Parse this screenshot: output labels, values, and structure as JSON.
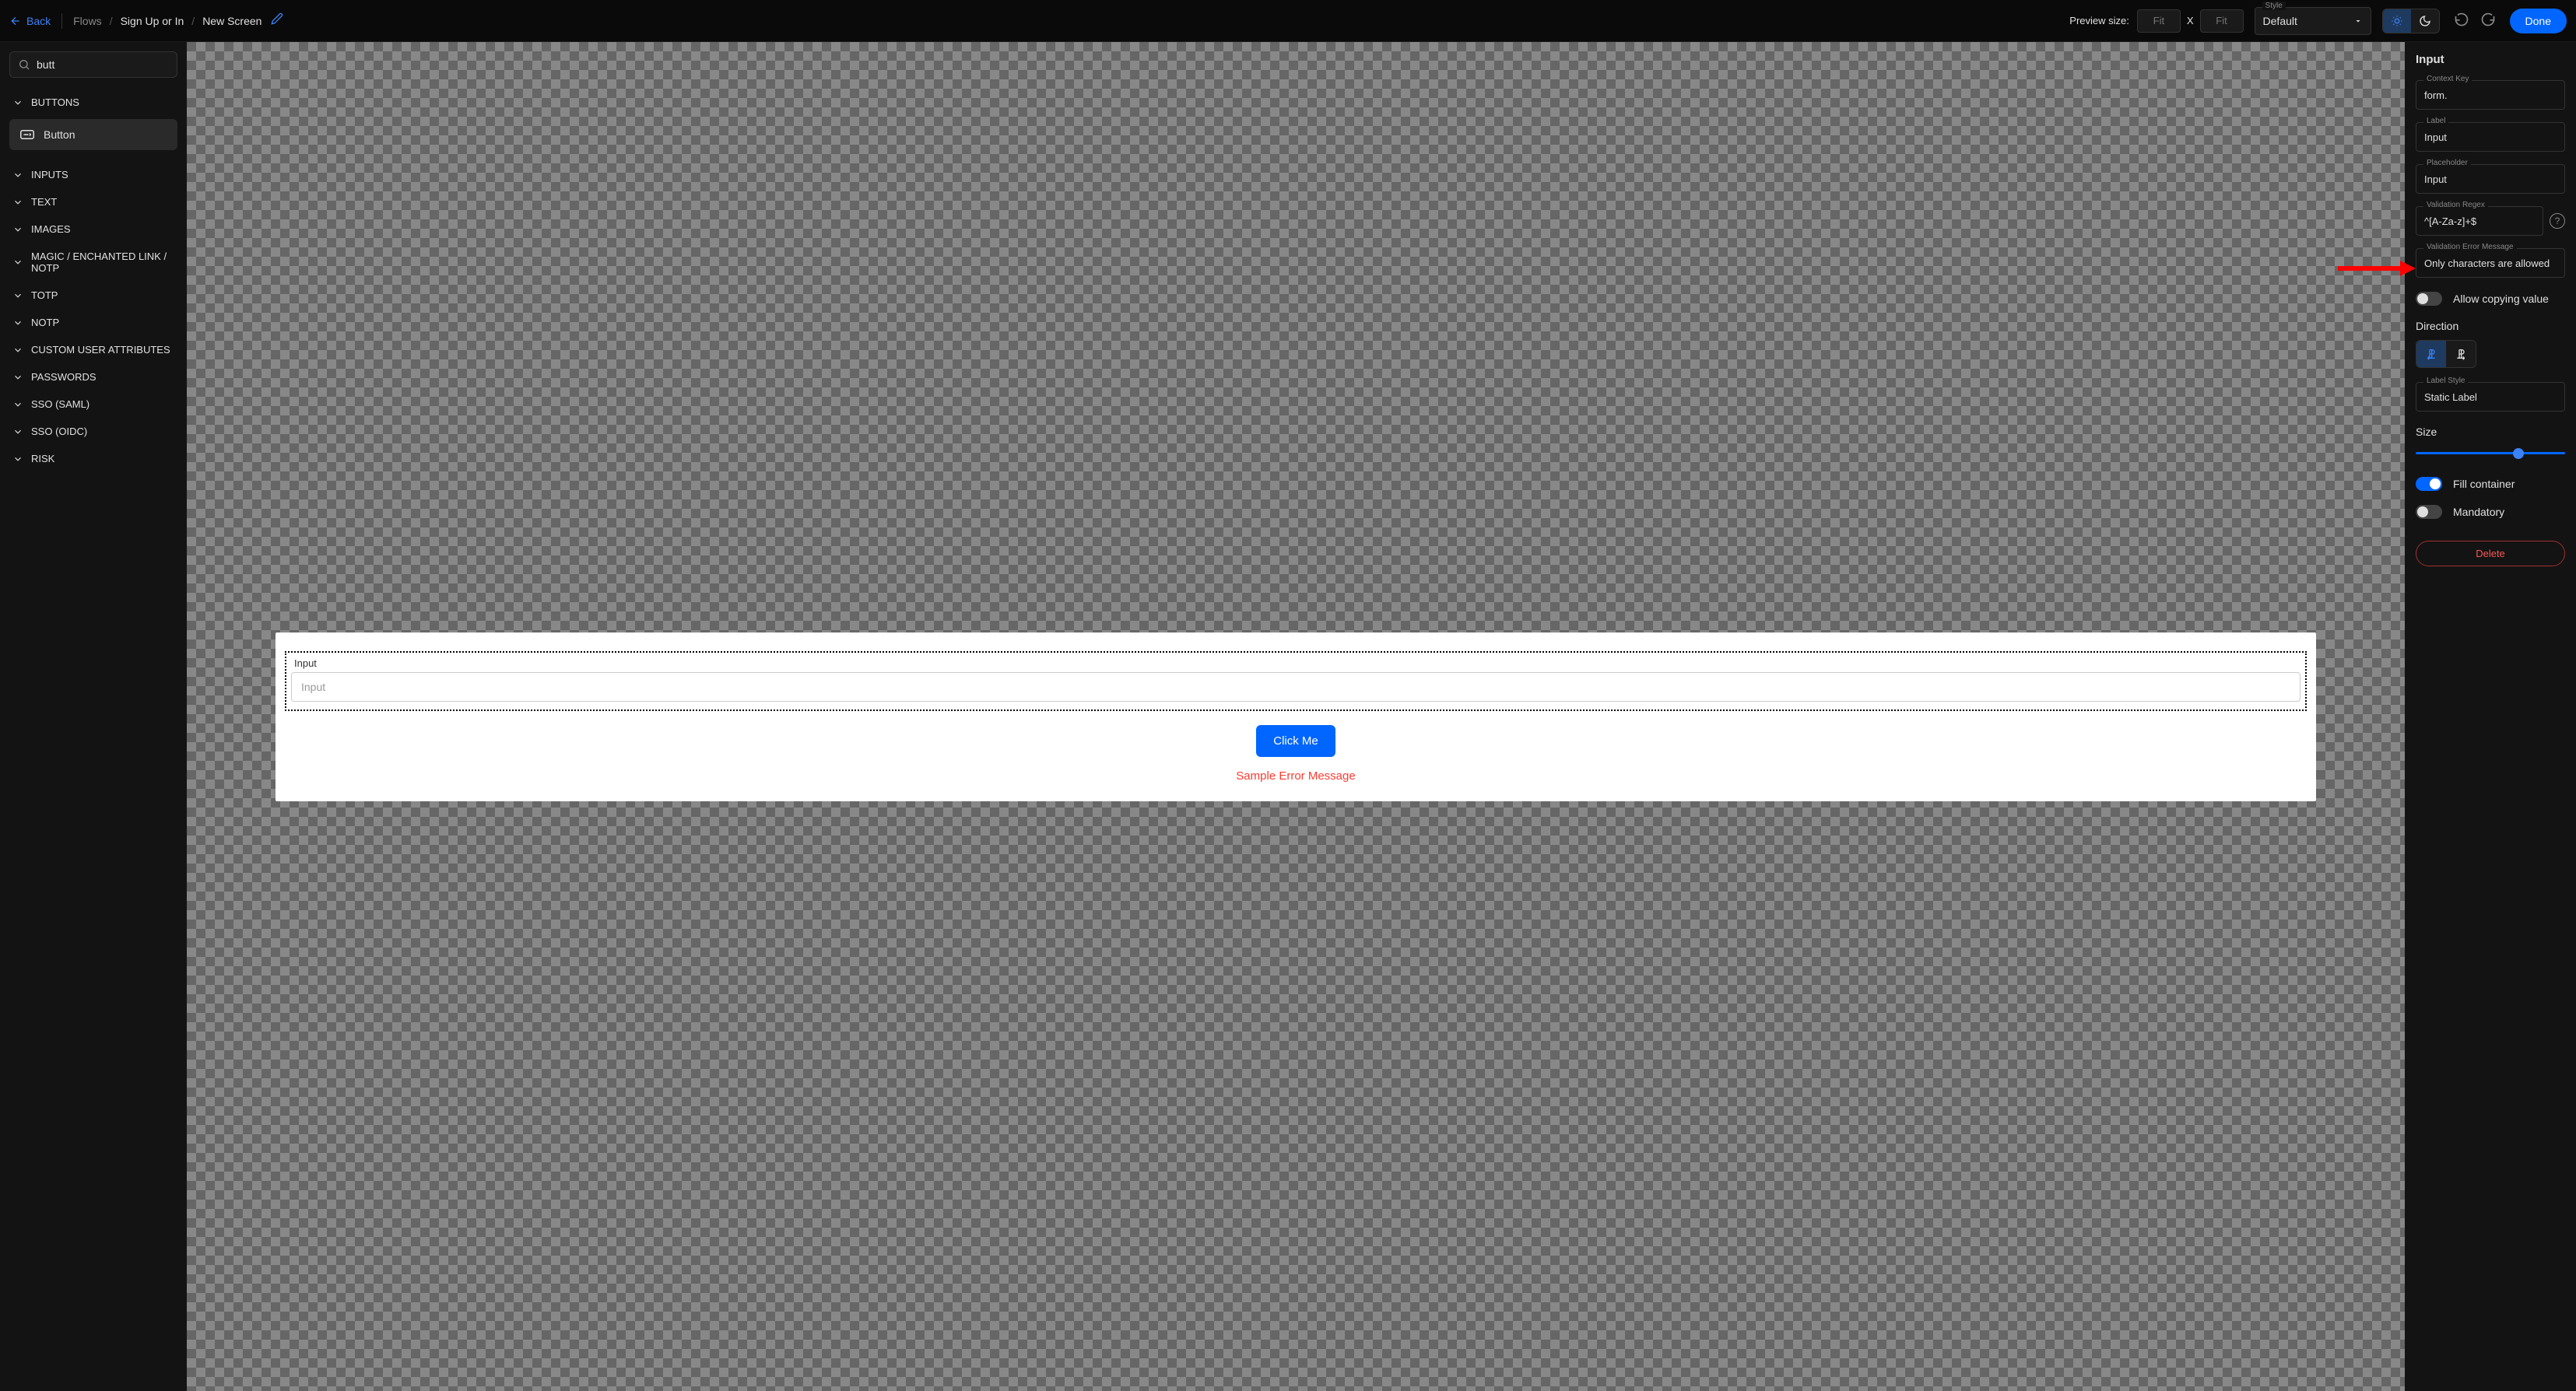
{
  "topbar": {
    "back": "Back",
    "breadcrumb": [
      "Flows",
      "Sign Up or In",
      "New Screen"
    ],
    "preview_label": "Preview size:",
    "preview_w": "Fit",
    "preview_x": "X",
    "preview_h": "Fit",
    "style_label": "Style",
    "style_value": "Default",
    "done": "Done"
  },
  "sidebar": {
    "search_value": "butt",
    "categories": [
      {
        "label": "BUTTONS",
        "open": true,
        "items": [
          {
            "label": "Button"
          }
        ]
      },
      {
        "label": "INPUTS"
      },
      {
        "label": "TEXT"
      },
      {
        "label": "IMAGES"
      },
      {
        "label": "MAGIC / ENCHANTED LINK / NOTP"
      },
      {
        "label": "TOTP"
      },
      {
        "label": "NOTP"
      },
      {
        "label": "CUSTOM USER ATTRIBUTES"
      },
      {
        "label": "PASSWORDS"
      },
      {
        "label": "SSO (SAML)"
      },
      {
        "label": "SSO (OIDC)"
      },
      {
        "label": "RISK"
      }
    ]
  },
  "canvas": {
    "input_label": "Input",
    "input_placeholder": "Input",
    "button_label": "Click Me",
    "error_message": "Sample Error Message"
  },
  "inspector": {
    "title": "Input",
    "fields": {
      "context_key": {
        "label": "Context Key",
        "value": "form."
      },
      "label": {
        "label": "Label",
        "value": "Input"
      },
      "placeholder": {
        "label": "Placeholder",
        "value": "Input"
      },
      "validation_regex": {
        "label": "Validation Regex",
        "value": "^[A-Za-z]+$"
      },
      "validation_error": {
        "label": "Validation Error Message",
        "value": "Only characters are allowed"
      },
      "label_style": {
        "label": "Label Style",
        "value": "Static Label"
      }
    },
    "allow_copy": {
      "label": "Allow copying value",
      "on": false
    },
    "direction_label": "Direction",
    "size_label": "Size",
    "fill_container": {
      "label": "Fill container",
      "on": true
    },
    "mandatory": {
      "label": "Mandatory",
      "on": false
    },
    "delete": "Delete"
  }
}
